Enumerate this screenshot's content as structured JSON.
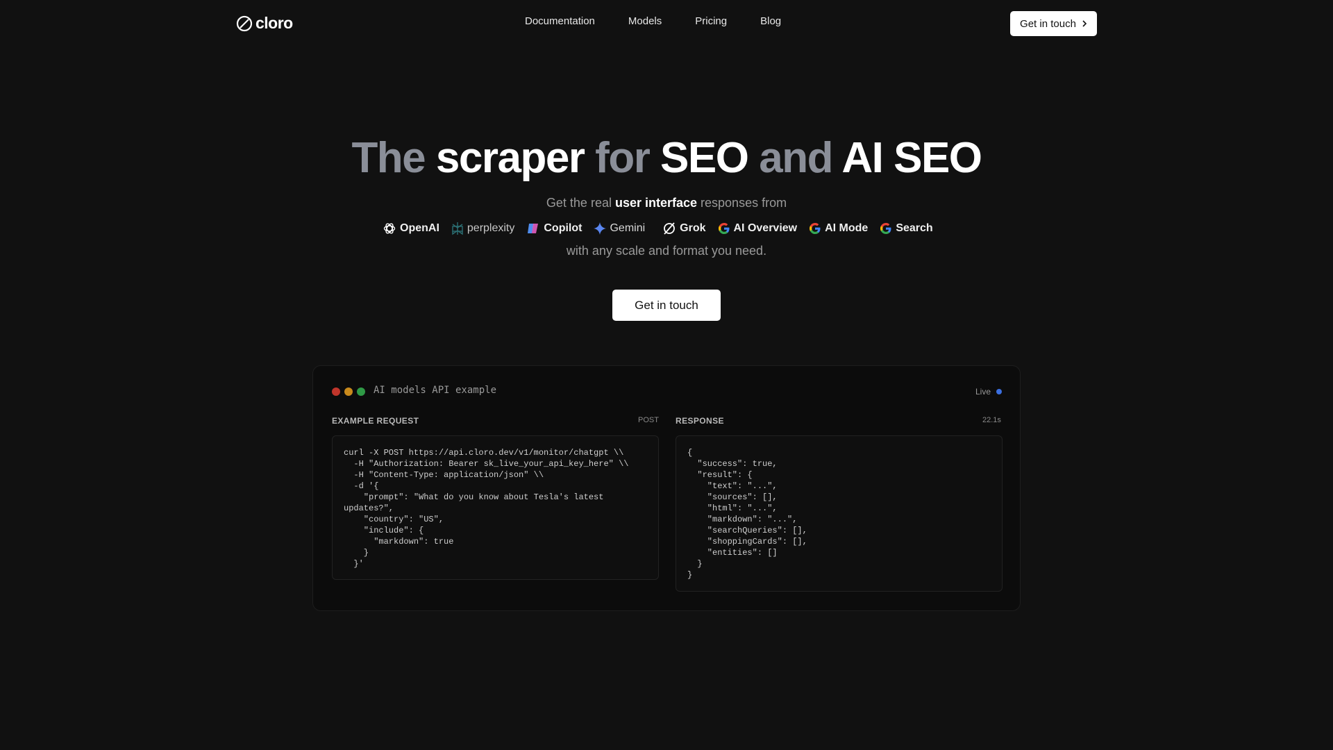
{
  "nav": {
    "logo_text": "cloro",
    "links": [
      "Documentation",
      "Models",
      "Pricing",
      "Blog"
    ],
    "cta_label": "Get in touch"
  },
  "hero": {
    "title_parts": [
      {
        "text": "The ",
        "tone": "dim"
      },
      {
        "text": "scraper ",
        "tone": "bright"
      },
      {
        "text": "for ",
        "tone": "dim"
      },
      {
        "text": "SEO ",
        "tone": "bright"
      },
      {
        "text": "and ",
        "tone": "dim"
      },
      {
        "text": "AI SEO",
        "tone": "bright"
      }
    ],
    "sub_pre": "Get the real ",
    "sub_strong": "user interface",
    "sub_post": " responses from",
    "brands": [
      {
        "label": "OpenAI",
        "icon": "openai-icon"
      },
      {
        "label": "perplexity",
        "icon": "perplexity-icon"
      },
      {
        "label": "Copilot",
        "icon": "copilot-icon"
      },
      {
        "label": "Gemini",
        "icon": "gemini-icon"
      },
      {
        "label": "Grok",
        "icon": "grok-icon"
      },
      {
        "label": "AI Overview",
        "icon": "google-icon"
      },
      {
        "label": "AI Mode",
        "icon": "google-icon"
      },
      {
        "label": "Search",
        "icon": "google-icon"
      }
    ],
    "sub_tail": "with any scale and format you need.",
    "cta_label": "Get in touch"
  },
  "panel": {
    "title": "AI models API example",
    "live_label": "Live",
    "dot_colors": [
      "#c0352b",
      "#c98a1c",
      "#2f9a46"
    ],
    "request_head": "EXAMPLE REQUEST",
    "request_method": "POST",
    "response_head": "RESPONSE",
    "response_time": "22.1s",
    "request_code": "curl -X POST https://api.cloro.dev/v1/monitor/chatgpt \\\\\n  -H \"Authorization: Bearer sk_live_your_api_key_here\" \\\\\n  -H \"Content-Type: application/json\" \\\\\n  -d '{\n    \"prompt\": \"What do you know about Tesla's latest\nupdates?\",\n    \"country\": \"US\",\n    \"include\": {\n      \"markdown\": true\n    }\n  }'",
    "response_code": "{\n  \"success\": true,\n  \"result\": {\n    \"text\": \"...\",\n    \"sources\": [],\n    \"html\": \"...\",\n    \"markdown\": \"...\",\n    \"searchQueries\": [],\n    \"shoppingCards\": [],\n    \"entities\": []\n  }\n}"
  }
}
